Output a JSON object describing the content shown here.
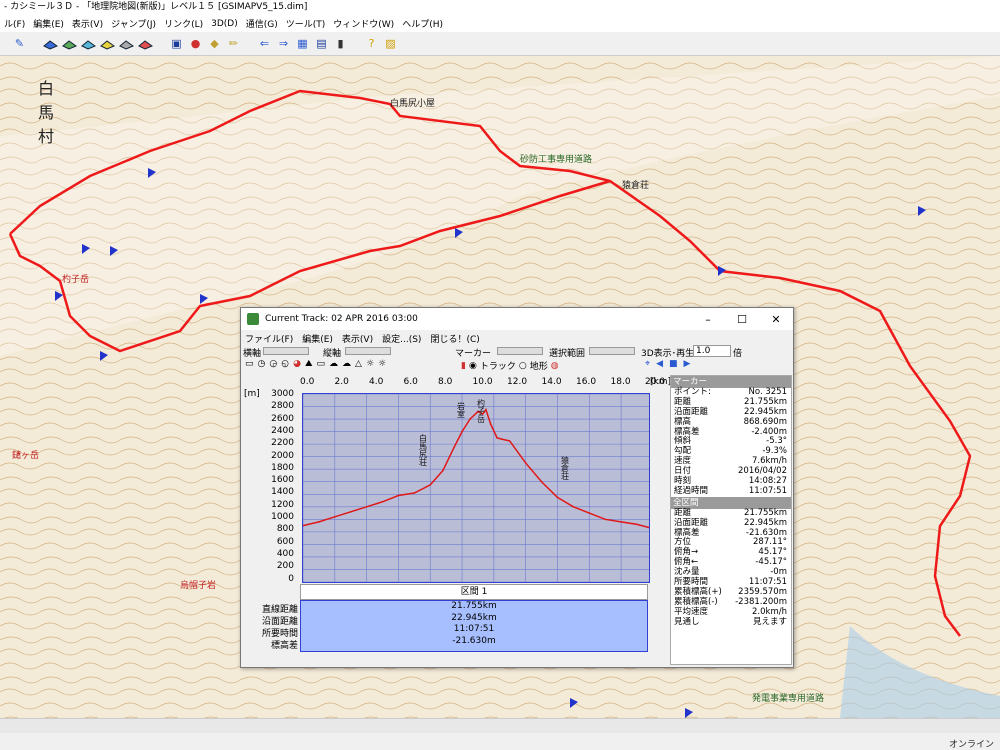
{
  "window": {
    "title": "- カシミール３Ｄ - 「地理院地図(新版)」レベル１５ [GSIMAPV5_15.dim]"
  },
  "menu": [
    "ル(F)",
    "編集(E)",
    "表示(V)",
    "ジャンプ(J)",
    "リンク(L)",
    "3D(D)",
    "通信(G)",
    "ツール(T)",
    "ウィンドウ(W)",
    "ヘルプ(H)"
  ],
  "status": {
    "online": "オンライン"
  },
  "map_labels": {
    "hakuba1": "白",
    "hakuba2": "馬",
    "hakuba3": "村",
    "hut1": "白馬尻小屋",
    "hut2": "猿倉荘",
    "peak1": "杓子岳",
    "peak2": "鑓ヶ岳",
    "peak3": "烏帽子岩",
    "road": "砂防工事専用道路",
    "road2": "発電事業専用道路"
  },
  "dialog": {
    "title": "Current Track: 02 APR 2016 03:00",
    "menu": [
      "ファイル(F)",
      "編集(E)",
      "表示(V)",
      "設定...(S)",
      "閉じる！(C)"
    ],
    "lbl_yoko": "横軸",
    "lbl_tate": "縦軸",
    "lbl_marker": "マーカー",
    "lbl_range": "選択範囲",
    "lbl_3d": "3D表示･再生",
    "speed": "1.0",
    "speed_unit": "倍",
    "radio_track": "トラック",
    "radio_terrain": "地形",
    "x_unit": "[km]",
    "y_unit": "[m]",
    "x_ticks": [
      "0.0",
      "2.0",
      "4.0",
      "6.0",
      "8.0",
      "10.0",
      "12.0",
      "14.0",
      "16.0",
      "18.0",
      "20.0"
    ],
    "y_ticks": [
      "3000",
      "2800",
      "2600",
      "2400",
      "2200",
      "2000",
      "1800",
      "1600",
      "1400",
      "1200",
      "1000",
      "800",
      "600",
      "400",
      "200",
      "0"
    ],
    "chart_labels": [
      "白馬尻荘",
      "岩室",
      "杓子岳",
      "猿倉荘"
    ],
    "section_header": "区間 1",
    "section_labels": [
      "直線距離",
      "沿面距離",
      "所要時間",
      "標高差"
    ],
    "section_values": [
      "21.755km",
      "22.945km",
      "11:07:51",
      "-21.630m"
    ],
    "marker_panel_title": "マーカー",
    "marker_rows": [
      [
        "ポイント:",
        "No. 3251"
      ],
      [
        "距離",
        "21.755km"
      ],
      [
        "沿面距離",
        "22.945km"
      ],
      [
        "標高",
        "868.690m"
      ],
      [
        "標高差",
        "-2.400m"
      ],
      [
        "傾斜",
        "-5.3°"
      ],
      [
        "勾配",
        "-9.3%"
      ],
      [
        "速度",
        "7.6km/h"
      ],
      [
        "日付",
        "2016/04/02"
      ],
      [
        "時刻",
        "14:08:27"
      ],
      [
        "経過時間",
        "11:07:51"
      ]
    ],
    "all_panel_title": "全区間",
    "all_rows": [
      [
        "距離",
        "21.755km"
      ],
      [
        "沿面距離",
        "22.945km"
      ],
      [
        "標高差",
        "-21.630m"
      ],
      [
        "方位",
        "287.11°"
      ],
      [
        "俯角→",
        "45.17°"
      ],
      [
        "俯角←",
        "-45.17°"
      ],
      [
        "沈み量",
        "-0m"
      ],
      [
        "所要時間",
        "11:07:51"
      ],
      [
        "累積標高(+)",
        "2359.570m"
      ],
      [
        "累積標高(-)",
        "-2381.200m"
      ],
      [
        "平均速度",
        "2.0km/h"
      ],
      [
        "見通し",
        "見えます"
      ]
    ]
  },
  "chart_data": {
    "type": "area",
    "xlabel": "[km]",
    "ylabel": "[m]",
    "xlim": [
      0,
      21.755
    ],
    "ylim": [
      0,
      3000
    ],
    "x": [
      0,
      1,
      2,
      3,
      4,
      5,
      6,
      7,
      8,
      8.8,
      9.5,
      10,
      10.5,
      11,
      11.3,
      11.5,
      11.8,
      12.2,
      12.5,
      13,
      14,
      15,
      16,
      17,
      18,
      19,
      20,
      21,
      21.755
    ],
    "series": [
      {
        "values": [
          900,
          960,
          1040,
          1120,
          1200,
          1280,
          1380,
          1420,
          1550,
          1780,
          2150,
          2400,
          2600,
          2720,
          2680,
          2750,
          2520,
          2300,
          2280,
          2250,
          1900,
          1600,
          1350,
          1200,
          1100,
          1000,
          960,
          920,
          870
        ]
      }
    ]
  }
}
